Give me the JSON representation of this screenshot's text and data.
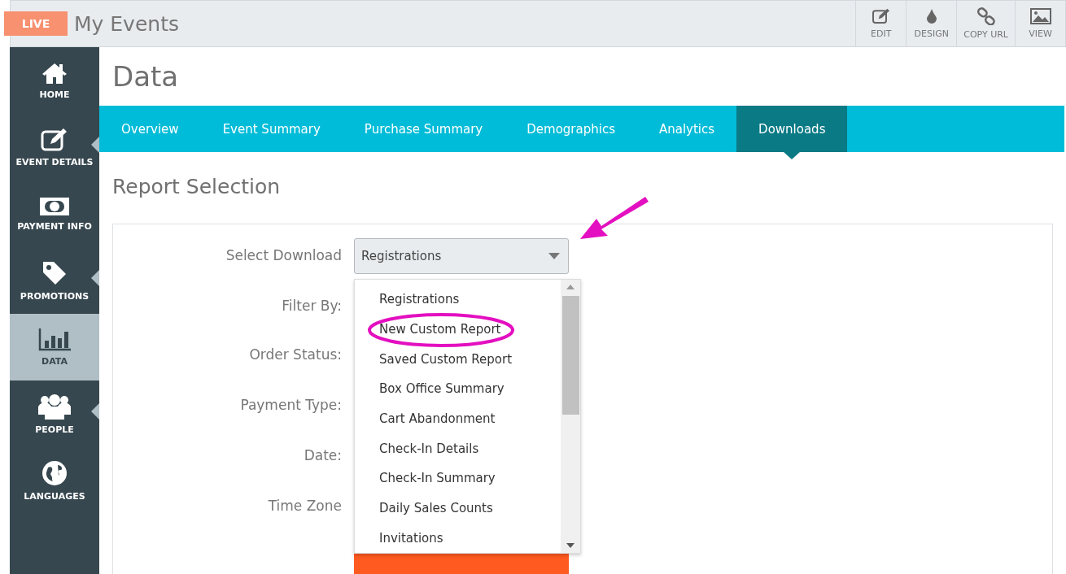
{
  "header": {
    "badge": "LIVE",
    "title": "My Events",
    "tools": [
      {
        "kind": "edit",
        "label": "EDIT"
      },
      {
        "kind": "design",
        "label": "DESIGN"
      },
      {
        "kind": "link",
        "label": "COPY URL"
      },
      {
        "kind": "view",
        "label": "VIEW"
      }
    ]
  },
  "sidebar": {
    "items": [
      {
        "kind": "home",
        "label": "HOME",
        "selected": false,
        "has_submenu": false
      },
      {
        "kind": "edit",
        "label": "EVENT DETAILS",
        "selected": false,
        "has_submenu": true
      },
      {
        "kind": "money",
        "label": "PAYMENT INFO",
        "selected": false,
        "has_submenu": false
      },
      {
        "kind": "tag",
        "label": "PROMOTIONS",
        "selected": false,
        "has_submenu": true
      },
      {
        "kind": "chart",
        "label": "DATA",
        "selected": true,
        "has_submenu": false
      },
      {
        "kind": "people",
        "label": "PEOPLE",
        "selected": false,
        "has_submenu": true
      },
      {
        "kind": "globe",
        "label": "LANGUAGES",
        "selected": false,
        "has_submenu": false
      }
    ]
  },
  "page_title": "Data",
  "tabs": [
    {
      "label": "Overview",
      "selected": false
    },
    {
      "label": "Event Summary",
      "selected": false
    },
    {
      "label": "Purchase Summary",
      "selected": false
    },
    {
      "label": "Demographics",
      "selected": false
    },
    {
      "label": "Analytics",
      "selected": false
    },
    {
      "label": "Downloads",
      "selected": true
    }
  ],
  "section_title": "Report Selection",
  "form": {
    "labels": [
      "Select Download",
      "Filter By:",
      "Order Status:",
      "Payment Type:",
      "Date:",
      "Time Zone"
    ],
    "select_value": "Registrations",
    "options": [
      {
        "label": "Registrations",
        "circled": false
      },
      {
        "label": "New Custom Report",
        "circled": true
      },
      {
        "label": "Saved Custom Report",
        "circled": false
      },
      {
        "label": "Box Office Summary",
        "circled": false
      },
      {
        "label": "Cart Abandonment",
        "circled": false
      },
      {
        "label": "Check-In Details",
        "circled": false
      },
      {
        "label": "Check-In Summary",
        "circled": false
      },
      {
        "label": "Daily Sales Counts",
        "circled": false
      },
      {
        "label": "Invitations",
        "circled": false
      }
    ]
  }
}
